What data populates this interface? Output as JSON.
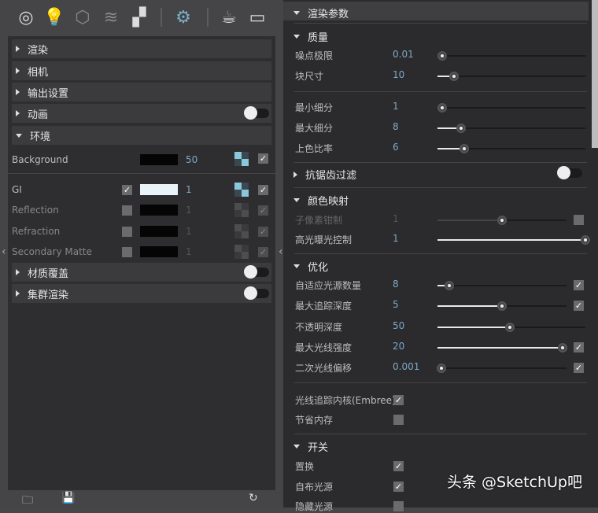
{
  "toolbar": {
    "icons": [
      "render-settings-icon",
      "light-icon",
      "geometry-icon",
      "layers-icon",
      "texture-icon",
      "settings-icon",
      "teapot-icon",
      "frame-buffer-icon"
    ]
  },
  "left": {
    "sections": [
      {
        "label": "渲染",
        "open": false
      },
      {
        "label": "相机",
        "open": false
      },
      {
        "label": "输出设置",
        "open": false
      },
      {
        "label": "动画",
        "open": false,
        "toggle": false
      },
      {
        "label": "环境",
        "open": true
      }
    ],
    "background": {
      "label": "Background",
      "value": "50",
      "color": "#050505"
    },
    "env_rows": [
      {
        "label": "GI",
        "checked": true,
        "color": "#e8f4fa",
        "value": "1",
        "enabled": true
      },
      {
        "label": "Reflection",
        "checked": false,
        "color": "#050505",
        "value": "1",
        "enabled": false
      },
      {
        "label": "Refraction",
        "checked": false,
        "color": "#050505",
        "value": "1",
        "enabled": false
      },
      {
        "label": "Secondary Matte",
        "checked": false,
        "color": "#050505",
        "value": "1",
        "enabled": false
      }
    ],
    "bottom_sections": [
      {
        "label": "材质覆盖",
        "toggle": false
      },
      {
        "label": "集群渲染",
        "toggle": false
      }
    ],
    "footer": {
      "icons": [
        "open-folder-icon",
        "save-icon",
        "reset-icon"
      ]
    }
  },
  "right": {
    "title": "渲染参数",
    "quality": {
      "label": "质量",
      "rows": [
        {
          "label": "噪点极限",
          "value": "0.01",
          "fraction": 0.03
        },
        {
          "label": "块尺寸",
          "value": "10",
          "fraction": 0.11
        },
        {
          "label": "最小细分",
          "value": "1",
          "fraction": 0.03
        },
        {
          "label": "最大细分",
          "value": "8",
          "fraction": 0.16
        },
        {
          "label": "上色比率",
          "value": "6",
          "fraction": 0.18
        }
      ]
    },
    "antialias": {
      "label": "抗锯齿过滤",
      "toggle": false
    },
    "colormap": {
      "label": "颜色映射",
      "rows": [
        {
          "label": "子像素钳制",
          "value": "1",
          "fraction": 0.5,
          "disabled": true,
          "checkbox": false
        },
        {
          "label": "高光曝光控制",
          "value": "1",
          "fraction": 1.0
        }
      ]
    },
    "optimize": {
      "label": "优化",
      "rows": [
        {
          "label": "自适应光源数量",
          "value": "8",
          "fraction": 0.09,
          "checkbox": true
        },
        {
          "label": "最大追踪深度",
          "value": "5",
          "fraction": 0.5,
          "checkbox": true
        },
        {
          "label": "不透明深度",
          "value": "50",
          "fraction": 0.49
        },
        {
          "label": "最大光线强度",
          "value": "20",
          "fraction": 0.97,
          "checkbox": true
        },
        {
          "label": "二次光线偏移",
          "value": "0.001",
          "fraction": 0.03,
          "checkbox": true
        }
      ],
      "embree": {
        "label": "光线追踪内核(Embree)",
        "checked": true
      },
      "save_memory": {
        "label": "节省内存",
        "checked": false
      }
    },
    "switches": {
      "label": "开关",
      "rows": [
        {
          "label": "置换",
          "checked": true
        },
        {
          "label": "自布光源",
          "checked": true
        },
        {
          "label": "隐藏光源",
          "checked": false
        }
      ]
    }
  },
  "watermark": "头条 @SketchUp吧"
}
